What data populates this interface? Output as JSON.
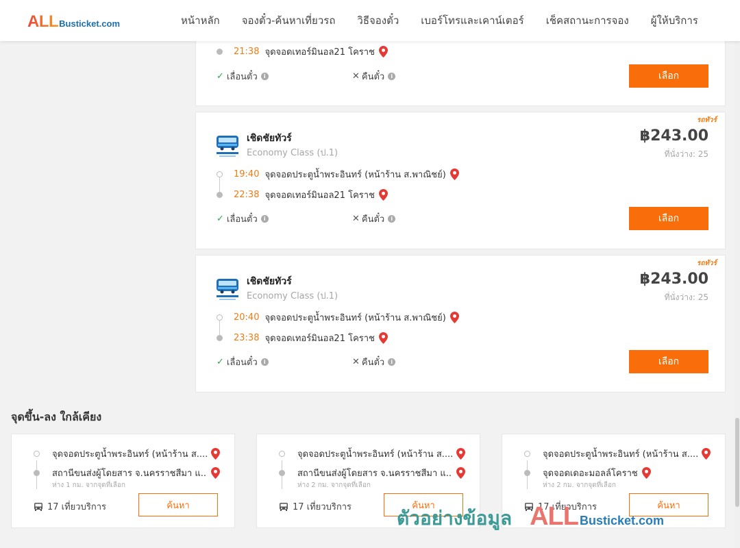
{
  "header": {
    "logo_all": "ALL",
    "logo_rest": "Busticket.com",
    "nav": [
      "หน้าหลัก",
      "จองตั๋ว-ค้นหาเที่ยวรถ",
      "วิธีจองตั๋ว",
      "เบอร์โทรและเคาน์เตอร์",
      "เช็คสถานะการจอง",
      "ผู้ให้บริการ"
    ]
  },
  "trips": [
    {
      "arrive_time": "21:38",
      "arrive_place": "จุดจอดเทอร์มินอล21 โคราช",
      "change_label": "เลื่อนตั๋ว",
      "refund_label": "คืนตั๋ว",
      "select_label": "เลือก"
    },
    {
      "promo": "รถทัวร์",
      "operator": "เชิดชัยทัวร์",
      "bus_class": "Economy Class (ป.1)",
      "price": "฿243.00",
      "seats": "ที่นั่งว่าง: 25",
      "depart_time": "19:40",
      "depart_place": "จุดจอดประตูน้ำพระอินทร์ (หน้าร้าน ส.พาณิชย์)",
      "arrive_time": "22:38",
      "arrive_place": "จุดจอดเทอร์มินอล21 โคราช",
      "change_label": "เลื่อนตั๋ว",
      "refund_label": "คืนตั๋ว",
      "select_label": "เลือก"
    },
    {
      "promo": "รถทัวร์",
      "operator": "เชิดชัยทัวร์",
      "bus_class": "Economy Class (ป.1)",
      "price": "฿243.00",
      "seats": "ที่นั่งว่าง: 25",
      "depart_time": "20:40",
      "depart_place": "จุดจอดประตูน้ำพระอินทร์ (หน้าร้าน ส.พาณิชย์)",
      "arrive_time": "23:38",
      "arrive_place": "จุดจอดเทอร์มินอล21 โคราช",
      "change_label": "เลื่อนตั๋ว",
      "refund_label": "คืนตั๋ว",
      "select_label": "เลือก"
    }
  ],
  "nearby": {
    "title": "จุดขึ้น-ลง ใกล้เคียง",
    "cards": [
      {
        "from": "จุดจอดประตูน้ำพระอินทร์ (หน้าร้าน ส....",
        "to": "สถานีขนส่งผู้โดยสาร จ.นครราชสีมา แ...",
        "distance": "ห่าง 1 กม. จากจุดที่เลือก",
        "trips": "17 เที่ยวบริการ",
        "button": "ค้นหา"
      },
      {
        "from": "จุดจอดประตูน้ำพระอินทร์ (หน้าร้าน ส....",
        "to": "สถานีขนส่งผู้โดยสาร จ.นครราชสีมา แ...",
        "distance": "ห่าง 2 กม. จากจุดที่เลือก",
        "trips": "17 เที่ยวบริการ",
        "button": "ค้นหา"
      },
      {
        "from": "จุดจอดประตูน้ำพระอินทร์ (หน้าร้าน ส....",
        "to": "จุดจอดเดอะมอลล์โคราช",
        "distance": "ห่าง 2 กม. จากจุดที่เลือก",
        "trips": "17 เที่ยวบริการ",
        "button": "ค้นหา"
      }
    ]
  },
  "watermark": {
    "thai": "ตัวอย่างข้อมูล",
    "all": "ALL",
    "rest": "Busticket.com"
  },
  "colors": {
    "accent": "#f96e0a",
    "time": "#f07b13",
    "check": "#2aa84a",
    "pin": "#e53935"
  },
  "icons": [
    "map-pin-icon",
    "check-icon",
    "cross-icon",
    "info-icon",
    "bus-icon",
    "operator-logo"
  ]
}
